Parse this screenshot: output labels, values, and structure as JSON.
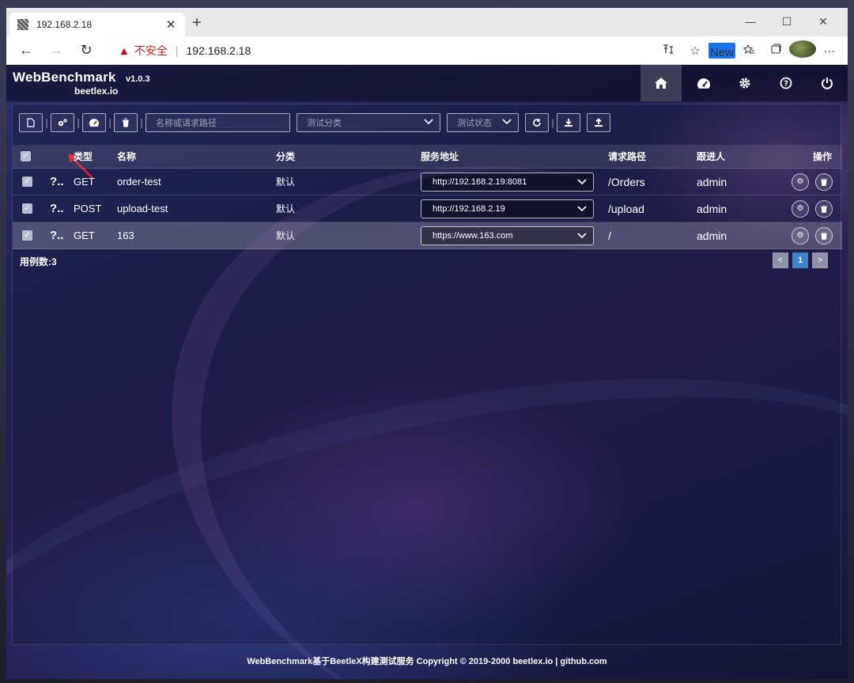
{
  "browser": {
    "tab_title": "192.168.2.18",
    "tab_close": "✕",
    "new_tab": "+",
    "minimize": "—",
    "maximize": "☐",
    "close": "✕",
    "back": "←",
    "forward": "→",
    "refresh": "↻",
    "warning_icon": "▲",
    "insecure_label": "不安全",
    "url": "192.168.2.18",
    "new_badge": "New"
  },
  "header": {
    "app_title": "WebBenchmark",
    "version": "v1.0.3",
    "subtitle": "beetlex.io"
  },
  "toolbar": {
    "search_placeholder": "名称或请求路径",
    "category_placeholder": "测试分类",
    "status_placeholder": "测试状态"
  },
  "table": {
    "headers": {
      "type": "类型",
      "name": "名称",
      "category": "分类",
      "service": "服务地址",
      "path": "请求路径",
      "owner": "跟进人",
      "actions": "操作"
    },
    "rows": [
      {
        "type": "GET",
        "name": "order-test",
        "category": "默认",
        "service": "http://192.168.2.19:8081",
        "path": "/Orders",
        "owner": "admin"
      },
      {
        "type": "POST",
        "name": "upload-test",
        "category": "默认",
        "service": "http://192.168.2.19",
        "path": "/upload",
        "owner": "admin"
      },
      {
        "type": "GET",
        "name": "163",
        "category": "默认",
        "service": "https://www.163.com",
        "path": "/",
        "owner": "admin"
      }
    ]
  },
  "summary": {
    "count_label": "用例数:3"
  },
  "pager": {
    "prev": "<",
    "current": "1",
    "next": ">"
  },
  "footer": {
    "text": "WebBenchmark基于BeetleX构建测试服务 Copyright © 2019-2000 beetlex.io | github.com"
  },
  "colors": {
    "pager_active": "#3d84c8",
    "insecure": "#c42b1c"
  }
}
